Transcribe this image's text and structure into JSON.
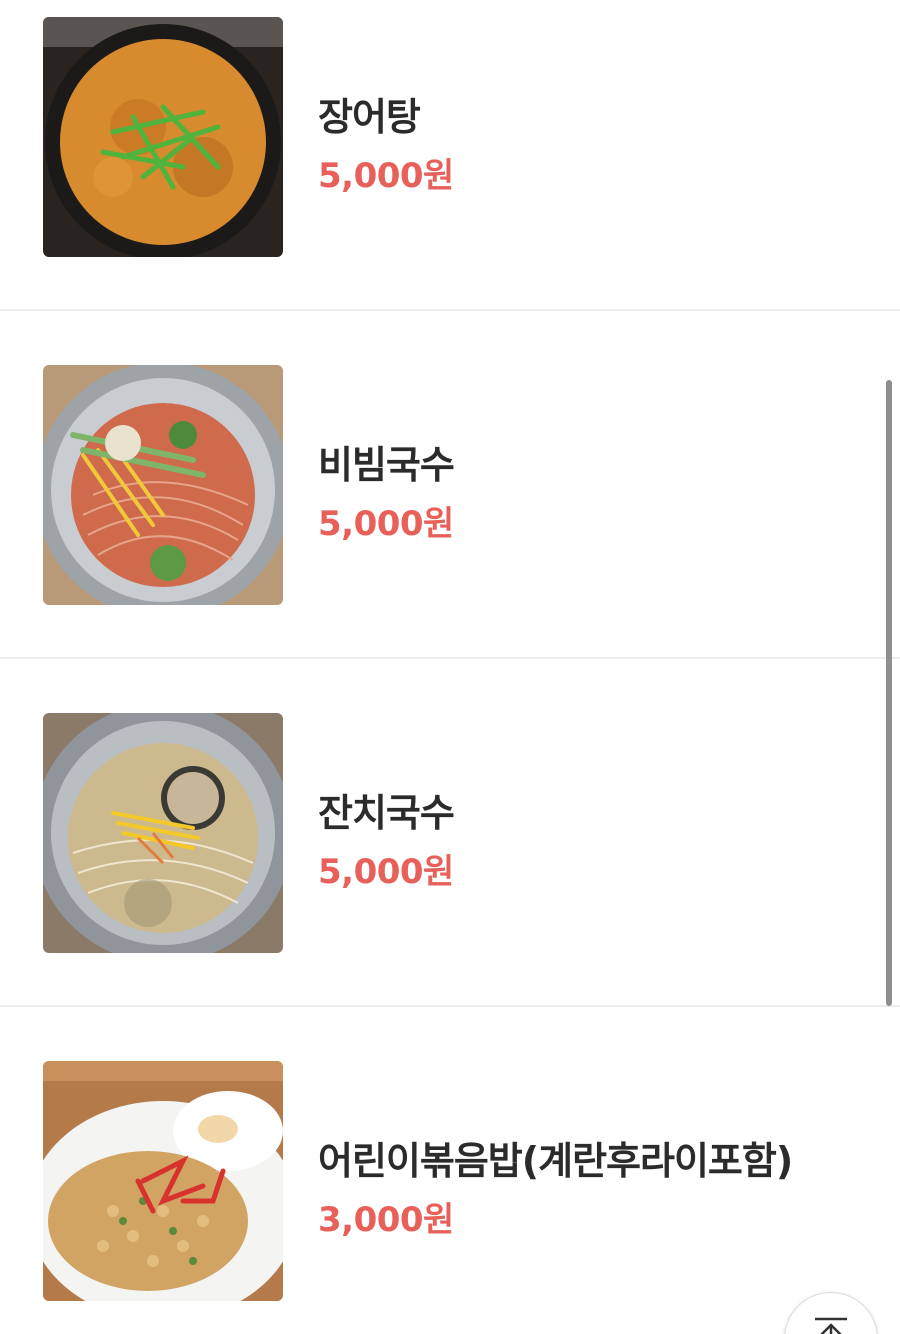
{
  "menu": {
    "items": [
      {
        "name": "장어탕",
        "price": "5,000원",
        "image": "eel-soup-photo"
      },
      {
        "name": "비빔국수",
        "price": "5,000원",
        "image": "spicy-noodles-photo"
      },
      {
        "name": "잔치국수",
        "price": "5,000원",
        "image": "banquet-noodles-photo"
      },
      {
        "name": "어린이볶음밥(계란후라이포함)",
        "price": "3,000원",
        "image": "kids-fried-rice-photo"
      }
    ]
  },
  "scroll_top_button": {
    "icon": "arrow-up-to-top-icon"
  },
  "colors": {
    "price": "#e8605a",
    "name": "#2b2b2b",
    "divider": "#ececec"
  }
}
